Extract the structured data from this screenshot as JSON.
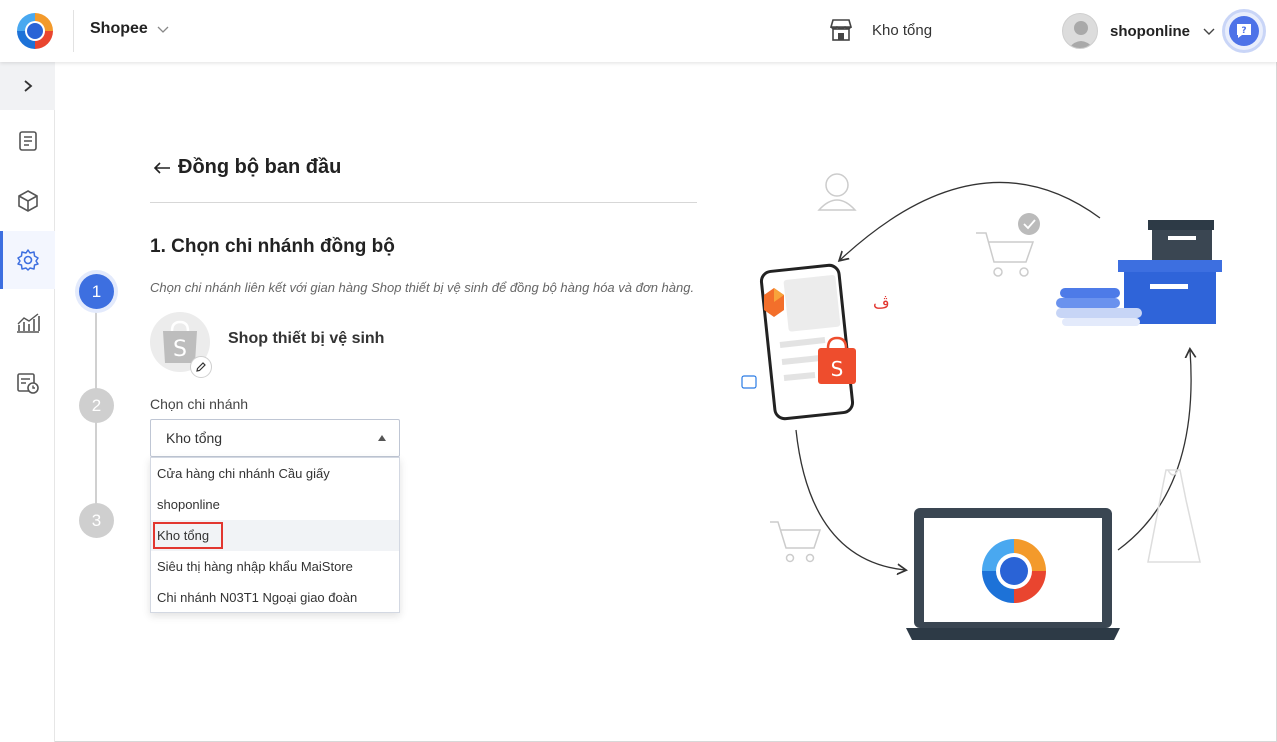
{
  "header": {
    "channel": "Shopee",
    "warehouse": "Kho tổng",
    "username": "shoponline"
  },
  "sidebar": {
    "items": [
      {
        "icon": "document-icon",
        "active": false
      },
      {
        "icon": "box-icon",
        "active": false
      },
      {
        "icon": "gear-icon",
        "active": true
      },
      {
        "icon": "chart-icon",
        "active": false
      },
      {
        "icon": "report-clock-icon",
        "active": false
      }
    ]
  },
  "page": {
    "title": "Đồng bộ ban đầu",
    "section_title": "1. Chọn chi nhánh đồng bộ",
    "description": "Chọn chi nhánh liên kết với gian hàng Shop thiết bị vệ sinh để đồng bộ hàng hóa và đơn hàng.",
    "shop_name": "Shop thiết bị vệ sinh",
    "shop_initial": "S",
    "steps": [
      "1",
      "2",
      "3"
    ]
  },
  "branch_select": {
    "label": "Chọn chi nhánh",
    "selected": "Kho tổng",
    "options": [
      "Cửa hàng chi nhánh Cầu giấy",
      "shoponline",
      "Kho tổng",
      "Siêu thị hàng nhập khẩu MaiStore",
      "Chi nhánh N03T1 Ngoại giao đoàn"
    ],
    "highlighted_index": 2
  },
  "colors": {
    "primary": "#3d6fe0",
    "shopee": "#ee4d2d",
    "highlight_border": "#e2362f"
  }
}
